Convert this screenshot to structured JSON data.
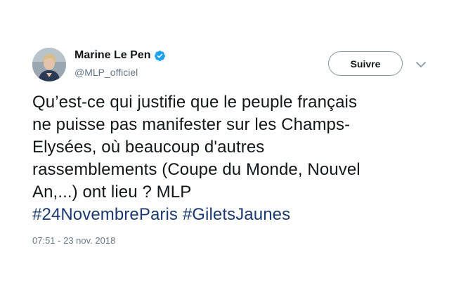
{
  "author": {
    "display_name": "Marine Le Pen",
    "handle": "@MLP_officiel",
    "verified_icon": "verified-badge-icon"
  },
  "actions": {
    "follow_label": "Suivre",
    "more_icon": "chevron-down-icon"
  },
  "tweet": {
    "lines": [
      "Qu’est-ce qui justifie que le peuple français",
      "ne puisse pas manifester sur les Champs-",
      "Elysées, où beaucoup d'autres",
      "rassemblements (Coupe du Monde, Nouvel",
      "An,...) ont lieu ? MLP"
    ],
    "hashtags": [
      "#24NovembreParis",
      "#GiletsJaunes"
    ],
    "timestamp": "07:51 - 23 nov. 2018"
  },
  "colors": {
    "hashtag": "#1b3a72",
    "verified": "#1da1f2",
    "secondary_text": "#657786"
  }
}
